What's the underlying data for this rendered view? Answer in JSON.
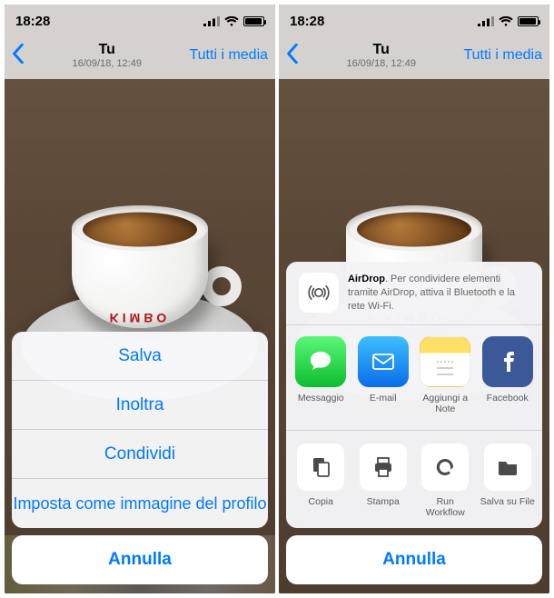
{
  "status": {
    "time": "18:28",
    "signal_icon": "signal-bars",
    "wifi_icon": "wifi",
    "battery_icon": "battery"
  },
  "nav": {
    "back_icon": "chevron-left",
    "title": "Tu",
    "subtitle": "16/09/18, 12:49",
    "right": "Tutti i media"
  },
  "photo": {
    "subject": "espresso-cup",
    "brand_text": "KIMBO"
  },
  "action_sheet": {
    "items": [
      {
        "label": "Salva",
        "name": "action-save"
      },
      {
        "label": "Inoltra",
        "name": "action-forward"
      },
      {
        "label": "Condividi",
        "name": "action-share"
      },
      {
        "label": "Imposta come immagine del profilo",
        "name": "action-set-profile"
      }
    ],
    "cancel": "Annulla"
  },
  "share_sheet": {
    "airdrop": {
      "title": "AirDrop",
      "text": ". Per condividere elementi tramite AirDrop, attiva il Bluetooth e la rete Wi‑Fi."
    },
    "apps": [
      {
        "label": "Messaggio",
        "name": "share-app-messages",
        "icon": "messages-icon"
      },
      {
        "label": "E-mail",
        "name": "share-app-mail",
        "icon": "mail-icon"
      },
      {
        "label": "Aggiungi a Note",
        "name": "share-app-notes",
        "icon": "notes-icon"
      },
      {
        "label": "Facebook",
        "name": "share-app-facebook",
        "icon": "facebook-icon"
      }
    ],
    "actions": [
      {
        "label": "Copia",
        "name": "share-action-copy",
        "icon": "copy-icon"
      },
      {
        "label": "Stampa",
        "name": "share-action-print",
        "icon": "print-icon"
      },
      {
        "label": "Run Workflow",
        "name": "share-action-workflow",
        "icon": "workflow-icon"
      },
      {
        "label": "Salva su File",
        "name": "share-action-files",
        "icon": "files-icon"
      }
    ],
    "cancel": "Annulla"
  }
}
